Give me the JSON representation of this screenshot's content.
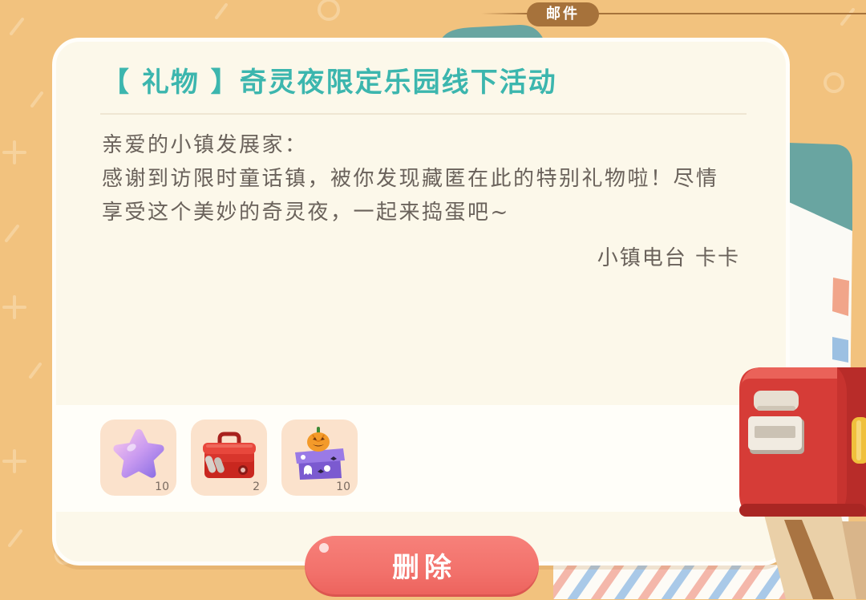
{
  "window": {
    "tab_label": "邮件"
  },
  "mail": {
    "title": "【 礼物 】奇灵夜限定乐园线下活动",
    "greeting": "亲爱的小镇发展家：",
    "body_lines": [
      "感谢到访限时童话镇，被你发现藏匿在此的特别礼物啦！尽情",
      "享受这个美妙的奇灵夜，一起来捣蛋吧~"
    ],
    "signature": "小镇电台 卡卡"
  },
  "rewards": [
    {
      "icon": "purple-star-icon",
      "count": "10"
    },
    {
      "icon": "red-toolbox-icon",
      "count": "2"
    },
    {
      "icon": "halloween-gift-box-icon",
      "count": "10"
    }
  ],
  "actions": {
    "delete_label": "删除"
  },
  "colors": {
    "background": "#f2c27e",
    "title": "#3cb6ae",
    "body_text": "#6a625b",
    "delete_button": "#f2716b",
    "tab": "#a6723b"
  }
}
